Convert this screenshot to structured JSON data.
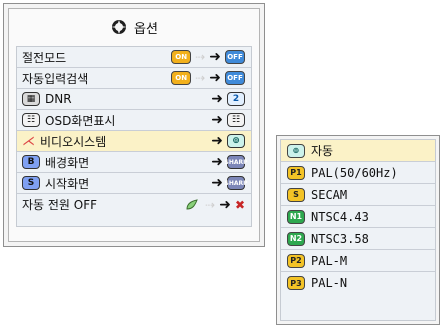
{
  "menu": {
    "title": "옵션",
    "items": [
      {
        "label": "절전모드",
        "left_icon": "",
        "state_from": "ON",
        "state_to": "OFF"
      },
      {
        "label": "자동입력검색",
        "left_icon": "",
        "state_from": "ON",
        "state_to": "OFF"
      },
      {
        "label": "DNR",
        "left_icon": "dnr-icon",
        "state_to": "2"
      },
      {
        "label": "OSD화면표시",
        "left_icon": "osd-icon",
        "state_to": ""
      },
      {
        "label": "비디오시스템",
        "left_icon": "video-system-icon",
        "state_to": "auto"
      },
      {
        "label": "배경화면",
        "left_icon": "background-icon",
        "state_to": "SHARP"
      },
      {
        "label": "시작화면",
        "left_icon": "start-screen-icon",
        "state_to": "SHARP"
      },
      {
        "label": "자동 전원 OFF",
        "left_icon": "",
        "state_to": "off-icon"
      }
    ]
  },
  "submenu": {
    "items": [
      {
        "code": "⊚",
        "label": "자동"
      },
      {
        "code": "P1",
        "label": "PAL(50/60Hz)"
      },
      {
        "code": "S",
        "label": "SECAM"
      },
      {
        "code": "N1",
        "label": "NTSC4.43"
      },
      {
        "code": "N2",
        "label": "NTSC3.58"
      },
      {
        "code": "P2",
        "label": "PAL-M"
      },
      {
        "code": "P3",
        "label": "PAL-N"
      }
    ]
  },
  "colors": {
    "highlight": "#fbf2c7",
    "panel_bg": "#eef2f6",
    "on": "#f2b01b",
    "off": "#3f8ad9",
    "green": "#2ea84f"
  }
}
